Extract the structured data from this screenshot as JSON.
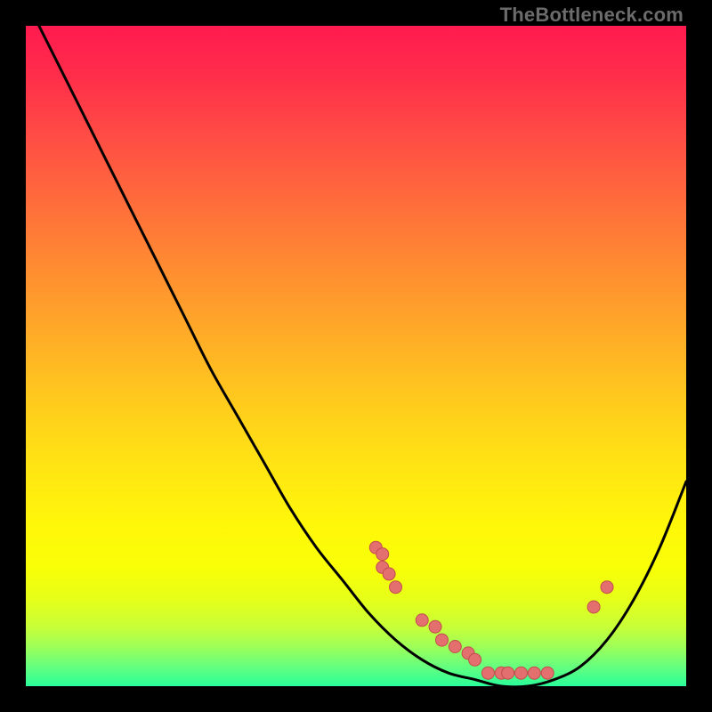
{
  "watermark": "TheBottleneck.com",
  "colors": {
    "curve": "#000000",
    "marker_fill": "#e46f6f",
    "marker_stroke": "#c24d4d",
    "gradient_top": "#ff1a4f",
    "gradient_bottom": "#2aff9a",
    "background": "#000000"
  },
  "chart_data": {
    "type": "line",
    "title": "",
    "xlabel": "",
    "ylabel": "",
    "xlim": [
      0,
      100
    ],
    "ylim": [
      0,
      100
    ],
    "series": [
      {
        "name": "bottleneck-curve",
        "x": [
          0,
          4,
          8,
          12,
          16,
          20,
          24,
          28,
          32,
          36,
          40,
          44,
          48,
          52,
          56,
          60,
          64,
          68,
          72,
          76,
          80,
          84,
          88,
          92,
          96,
          100
        ],
        "y": [
          104,
          96,
          88,
          80,
          72,
          64,
          56,
          48,
          41,
          34,
          27,
          21,
          16,
          11,
          7,
          4,
          2,
          1,
          0,
          0,
          1,
          3,
          7,
          13,
          21,
          31
        ]
      }
    ],
    "markers": {
      "name": "highlight-points",
      "x": [
        53,
        54,
        54,
        55,
        56,
        60,
        62,
        63,
        65,
        67,
        68,
        70,
        72,
        73,
        75,
        77,
        79,
        86,
        88
      ],
      "y": [
        21,
        20,
        18,
        17,
        15,
        10,
        9,
        7,
        6,
        5,
        4,
        2,
        2,
        2,
        2,
        2,
        2,
        12,
        15
      ]
    }
  }
}
